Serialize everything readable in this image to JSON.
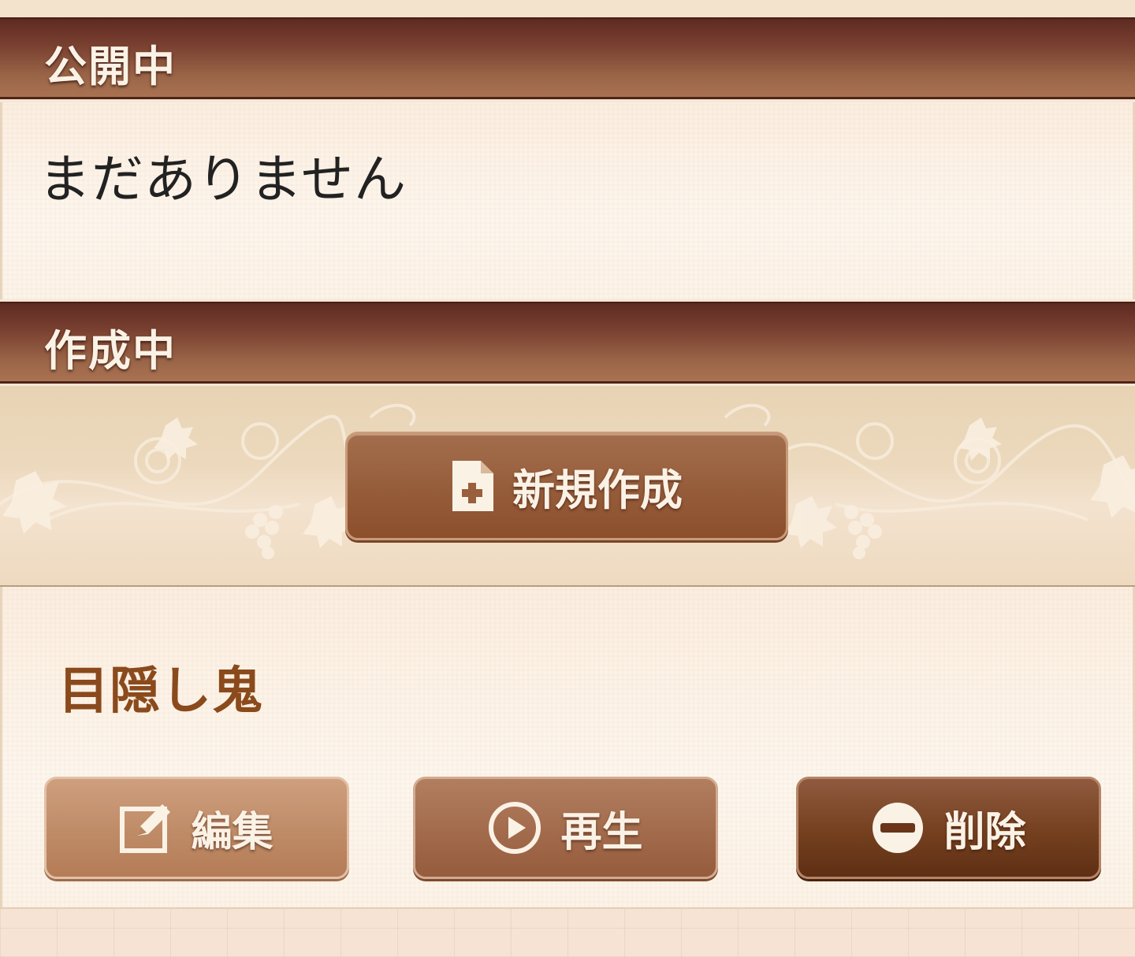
{
  "sections": {
    "published": {
      "header": "公開中",
      "empty_message": "まだありません"
    },
    "drafts": {
      "header": "作成中",
      "create_button": "新規作成",
      "items": [
        {
          "title": "目隠し鬼",
          "edit_label": "編集",
          "play_label": "再生",
          "delete_label": "削除"
        }
      ]
    }
  },
  "colors": {
    "header_bg": "#7a4131",
    "title_text": "#8a4a1c",
    "panel_bg": "#fdf6ee"
  },
  "icons": {
    "create": "new-document-icon",
    "edit": "edit-icon",
    "play": "play-icon",
    "delete": "minus-circle-icon"
  }
}
